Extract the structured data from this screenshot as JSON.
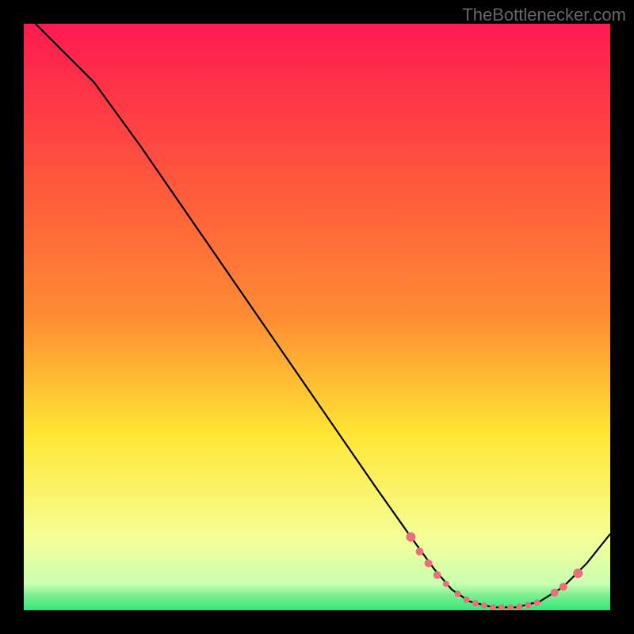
{
  "watermark": "TheBottlenecker.com",
  "chart_data": {
    "type": "line",
    "title": "",
    "xlabel": "",
    "ylabel": "",
    "xlim": [
      0,
      100
    ],
    "ylim": [
      0,
      100
    ],
    "background_gradient": {
      "top": "#ff1a50",
      "mid_top": "#ff8c33",
      "mid": "#ffe633",
      "low": "#f5ff99",
      "bottom": "#33e67a"
    },
    "series": [
      {
        "name": "curve",
        "color": "#000000",
        "points": [
          {
            "x": 2,
            "y": 100
          },
          {
            "x": 6,
            "y": 96
          },
          {
            "x": 12,
            "y": 90
          },
          {
            "x": 20,
            "y": 79
          },
          {
            "x": 30,
            "y": 64.5
          },
          {
            "x": 40,
            "y": 50
          },
          {
            "x": 50,
            "y": 35.5
          },
          {
            "x": 60,
            "y": 21
          },
          {
            "x": 66,
            "y": 12.5
          },
          {
            "x": 70,
            "y": 7
          },
          {
            "x": 73,
            "y": 3.5
          },
          {
            "x": 76,
            "y": 1.5
          },
          {
            "x": 80,
            "y": 0.5
          },
          {
            "x": 84,
            "y": 0.5
          },
          {
            "x": 88,
            "y": 1.5
          },
          {
            "x": 92,
            "y": 4
          },
          {
            "x": 96,
            "y": 8
          },
          {
            "x": 100,
            "y": 13
          }
        ]
      }
    ],
    "markers": {
      "color": "#e8707a",
      "radius_small": 4,
      "radius_large": 6,
      "points": [
        {
          "x": 66,
          "y": 12.5,
          "r": 6
        },
        {
          "x": 67.5,
          "y": 10,
          "r": 5
        },
        {
          "x": 69,
          "y": 8,
          "r": 5
        },
        {
          "x": 70.5,
          "y": 6,
          "r": 5
        },
        {
          "x": 72,
          "y": 4.5,
          "r": 4
        },
        {
          "x": 74,
          "y": 2.8,
          "r": 4
        },
        {
          "x": 75.5,
          "y": 1.8,
          "r": 4
        },
        {
          "x": 77,
          "y": 1.2,
          "r": 4
        },
        {
          "x": 78.5,
          "y": 0.8,
          "r": 4
        },
        {
          "x": 80,
          "y": 0.5,
          "r": 4
        },
        {
          "x": 81.5,
          "y": 0.5,
          "r": 4
        },
        {
          "x": 83,
          "y": 0.5,
          "r": 4
        },
        {
          "x": 84.5,
          "y": 0.6,
          "r": 4
        },
        {
          "x": 86,
          "y": 0.9,
          "r": 4
        },
        {
          "x": 87.5,
          "y": 1.3,
          "r": 4
        },
        {
          "x": 90.5,
          "y": 3,
          "r": 5
        },
        {
          "x": 92,
          "y": 4,
          "r": 5
        },
        {
          "x": 94.5,
          "y": 6.3,
          "r": 6
        }
      ]
    }
  }
}
